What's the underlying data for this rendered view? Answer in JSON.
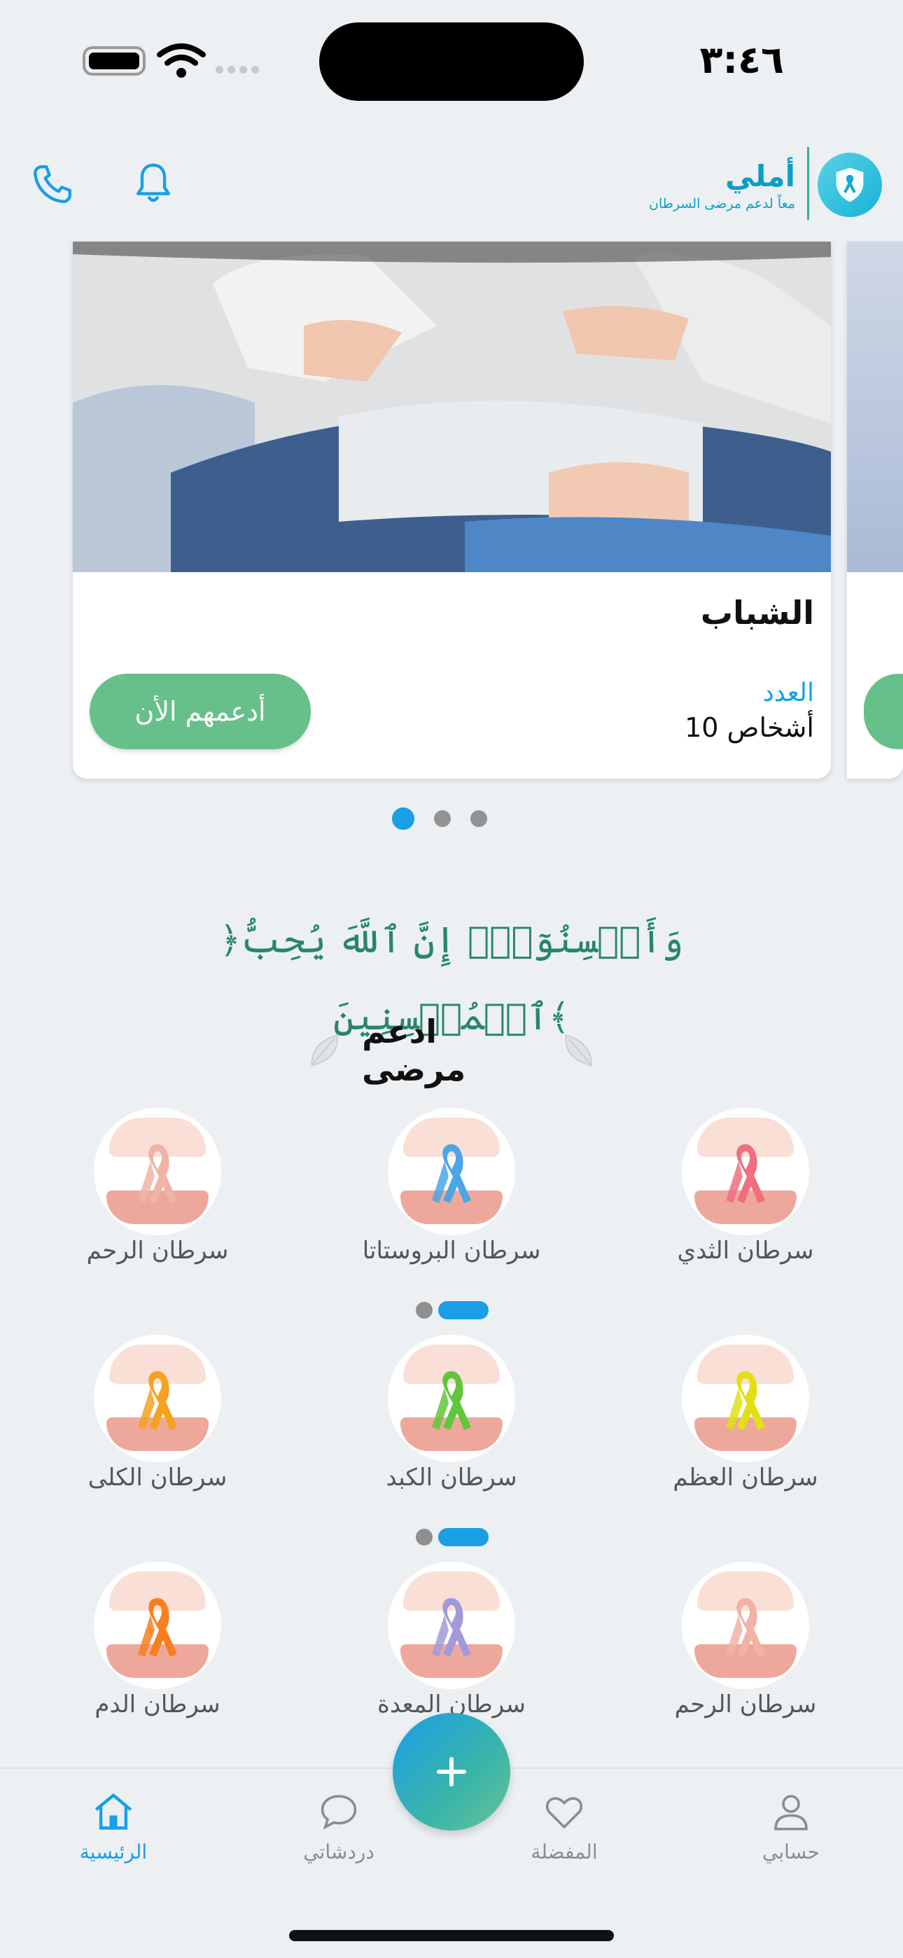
{
  "status_bar": {
    "time": "٣:٤٦"
  },
  "header": {
    "app_name": "أملي",
    "tagline": "معاً لدعم مرضى السرطان",
    "phone_icon": "phone-icon",
    "bell_icon": "bell-icon",
    "logo_icon": "shield-ribbon-icon"
  },
  "carousel": {
    "card": {
      "title": "الشباب",
      "count_label": "العدد",
      "count_value": "10 أشخاص",
      "button_label": "أدعمهم الأن"
    },
    "pages": 3,
    "active_page": 0
  },
  "verse": "﴿وَأَحۡسِنُوٓاْۚ إِنَّ ٱللَّهَ يُحِبُّ ٱلۡمُحۡسِنِينَ﴾",
  "support_section": {
    "title": "ادعم مرضى",
    "rows": [
      {
        "items": [
          {
            "label": "سرطان الثدي",
            "ribbon_color": "#ef6f80"
          },
          {
            "label": "سرطان البروستاتا",
            "ribbon_color": "#4aa6e6"
          },
          {
            "label": "سرطان الرحم",
            "ribbon_color": "#f0b3a6"
          }
        ]
      },
      {
        "items": [
          {
            "label": "سرطان العظم",
            "ribbon_color": "#e2df16"
          },
          {
            "label": "سرطان الكبد",
            "ribbon_color": "#62c63b"
          },
          {
            "label": "سرطان الكلى",
            "ribbon_color": "#f5a21e"
          }
        ]
      },
      {
        "items": [
          {
            "label": "سرطان الرحم",
            "ribbon_color": "#f0b3a6"
          },
          {
            "label": "سرطان المعدة",
            "ribbon_color": "#a29ad8"
          },
          {
            "label": "سرطان الدم",
            "ribbon_color": "#f6801f"
          }
        ]
      }
    ]
  },
  "tab_bar": {
    "tabs": [
      {
        "label": "حسابي",
        "icon": "user-icon"
      },
      {
        "label": "المفضلة",
        "icon": "heart-icon"
      },
      {
        "label": "دردشاتي",
        "icon": "chat-icon"
      },
      {
        "label": "الرئيسية",
        "icon": "home-icon",
        "active": true
      }
    ],
    "fab_icon": "plus-icon"
  },
  "colors": {
    "accent": "#1a9ee6",
    "button_green": "#67c08a",
    "verse_green": "#29866b",
    "background": "#ecf0f3"
  }
}
